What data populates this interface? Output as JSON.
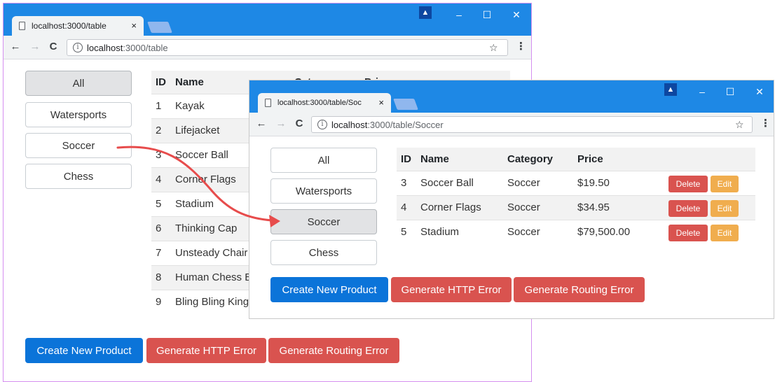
{
  "back_window": {
    "tab_title": "localhost:3000/table",
    "close_glyph": "×",
    "url_host": "localhost",
    "url_path": ":3000/table",
    "categories": [
      "All",
      "Watersports",
      "Soccer",
      "Chess"
    ],
    "active_category": "All",
    "table_headers": [
      "ID",
      "Name",
      "Cat",
      "Pri"
    ],
    "rows": [
      {
        "id": "1",
        "name": "Kayak"
      },
      {
        "id": "2",
        "name": "Lifejacket"
      },
      {
        "id": "3",
        "name": "Soccer Ball"
      },
      {
        "id": "4",
        "name": "Corner Flags"
      },
      {
        "id": "5",
        "name": "Stadium"
      },
      {
        "id": "6",
        "name": "Thinking Cap"
      },
      {
        "id": "7",
        "name": "Unsteady Chair"
      },
      {
        "id": "8",
        "name": "Human Chess B"
      },
      {
        "id": "9",
        "name": "Bling Bling King"
      }
    ],
    "buttons": {
      "create": "Create New Product",
      "http_error": "Generate HTTP Error",
      "routing_error": "Generate Routing Error"
    }
  },
  "front_window": {
    "tab_title": "localhost:3000/table/Soc",
    "close_glyph": "×",
    "url_host": "localhost",
    "url_path": ":3000/table/Soccer",
    "categories": [
      "All",
      "Watersports",
      "Soccer",
      "Chess"
    ],
    "active_category": "Soccer",
    "table_headers": [
      "ID",
      "Name",
      "Category",
      "Price"
    ],
    "rows": [
      {
        "id": "3",
        "name": "Soccer Ball",
        "category": "Soccer",
        "price": "$19.50"
      },
      {
        "id": "4",
        "name": "Corner Flags",
        "category": "Soccer",
        "price": "$34.95"
      },
      {
        "id": "5",
        "name": "Stadium",
        "category": "Soccer",
        "price": "$79,500.00"
      }
    ],
    "row_actions": {
      "delete": "Delete",
      "edit": "Edit"
    },
    "buttons": {
      "create": "Create New Product",
      "http_error": "Generate HTTP Error",
      "routing_error": "Generate Routing Error"
    }
  },
  "window_controls": {
    "minimize": "–",
    "maximize": "☐",
    "close": "✕"
  },
  "icons": {
    "back": "←",
    "forward": "→",
    "reload": "C",
    "info": "i",
    "star": "☆",
    "menu": "⋮",
    "profile": "▲"
  },
  "colors": {
    "titlebar": "#1e88e5",
    "primary": "#0b74d9",
    "danger": "#d9534f",
    "warning": "#f0ad4e",
    "arrow": "#e74c4c"
  }
}
